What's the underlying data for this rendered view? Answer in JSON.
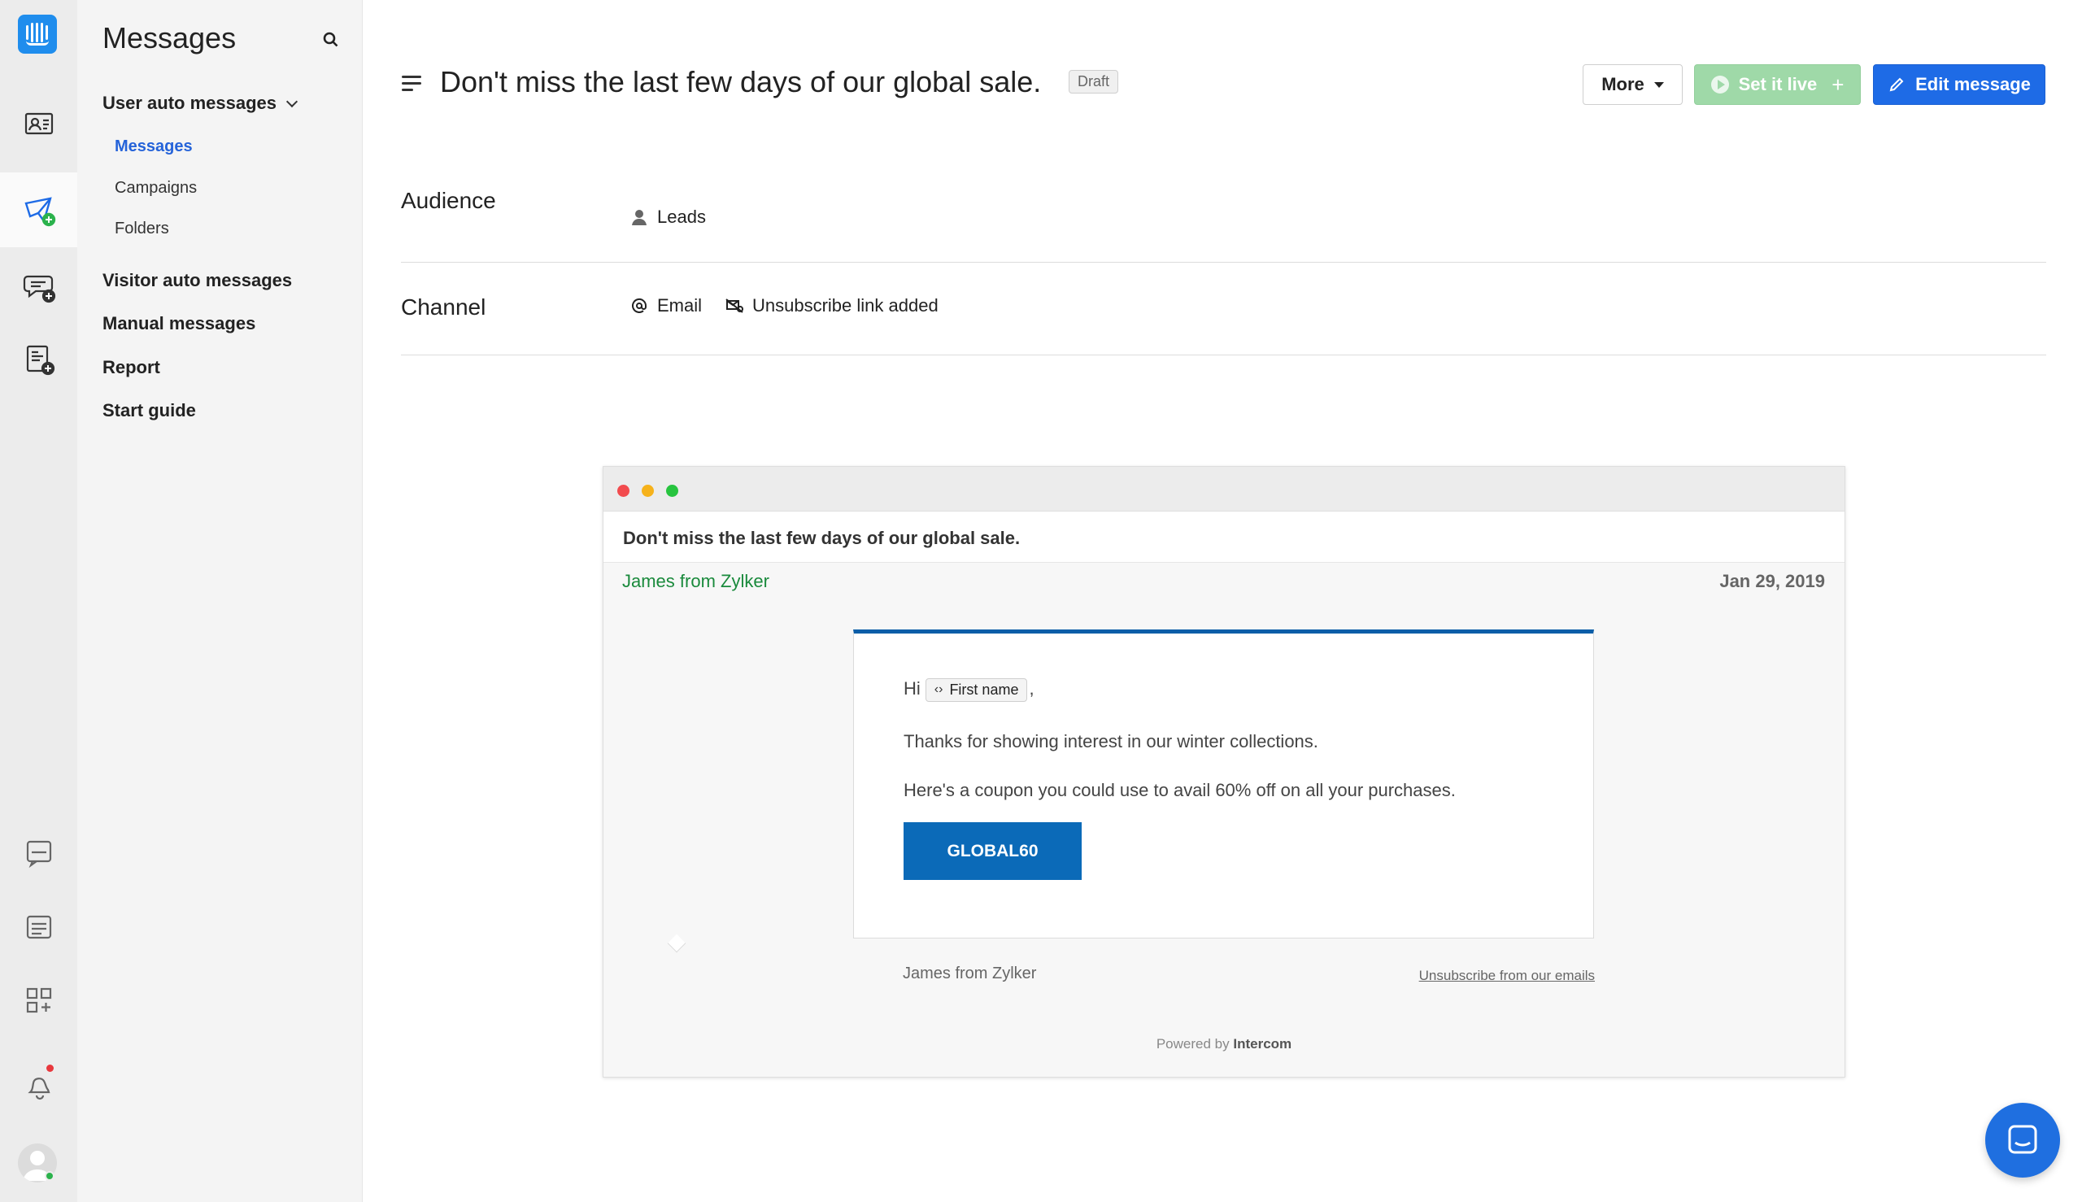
{
  "sidebar": {
    "title": "Messages",
    "group_user": "User auto messages",
    "sub_items": [
      "Messages",
      "Campaigns",
      "Folders"
    ],
    "other_items": [
      "Visitor auto messages",
      "Manual messages",
      "Report",
      "Start guide"
    ]
  },
  "header": {
    "title": "Don't miss the last few days of our global sale.",
    "status_badge": "Draft",
    "more_label": "More",
    "set_live_label": "Set it live",
    "edit_label": "Edit message"
  },
  "details": {
    "audience_label": "Audience",
    "audience_value": "Leads",
    "channel_label": "Channel",
    "channel_value": "Email",
    "unsubscribe_note": "Unsubscribe link added"
  },
  "preview": {
    "subject": "Don't miss the last few days of our global sale.",
    "from": "James from Zylker",
    "date": "Jan 29, 2019",
    "greeting": "Hi",
    "attribute_chip": "First name",
    "line1": "Thanks for showing interest in our winter collections.",
    "line2": "Here's a coupon you could use to avail 60% off on all your purchases.",
    "coupon": "GLOBAL60",
    "signer": "James from Zylker",
    "unsubscribe": "Unsubscribe from our emails",
    "powered_prefix": "Powered by",
    "powered_brand": "Intercom"
  },
  "colors": {
    "primary": "#1e6be6",
    "live_button": "#9fd9a8",
    "from_green": "#1a8a3c",
    "coupon_blue": "#0b6ab8"
  }
}
